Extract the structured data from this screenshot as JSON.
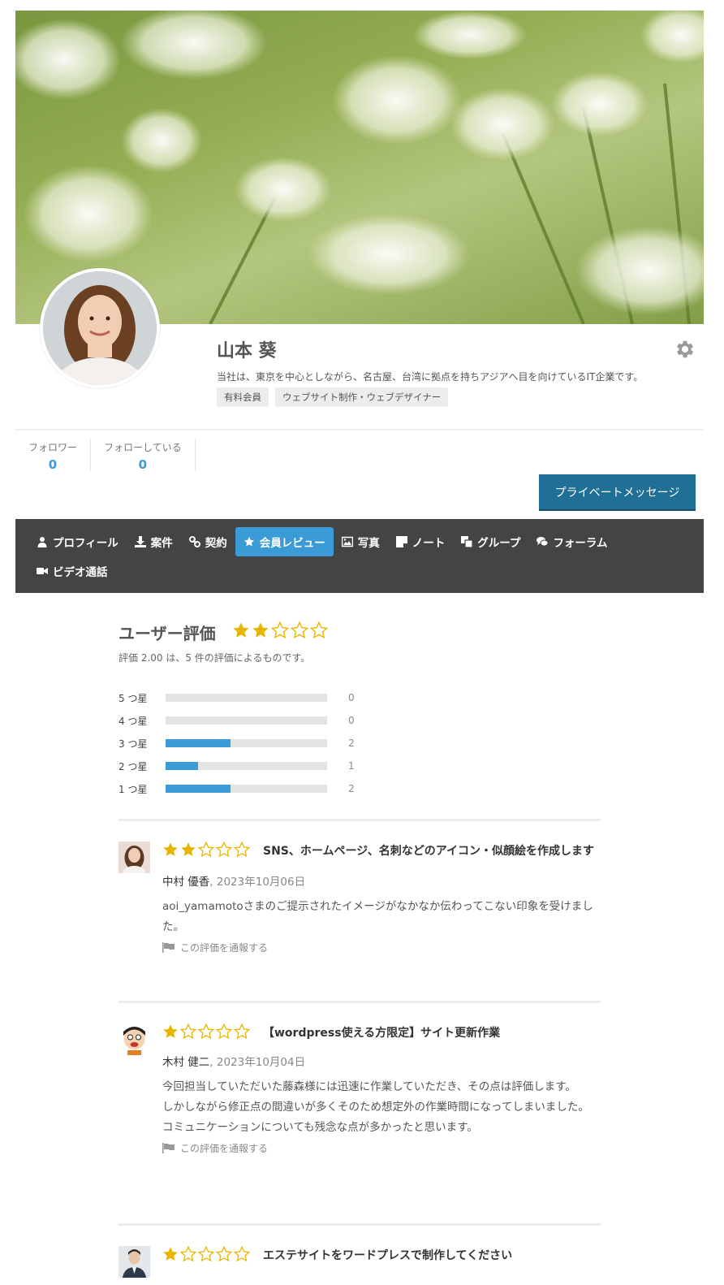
{
  "profile": {
    "name": "山本 葵",
    "description": "当社は、東京を中心としながら、名古屋、台湾に拠点を持ちアジアへ目を向けているIT企業です。",
    "tags": [
      "有料会員",
      "ウェブサイト制作・ウェブデザイナー"
    ]
  },
  "stats": {
    "followers_label": "フォロワー",
    "followers_count": "0",
    "following_label": "フォローしている",
    "following_count": "0"
  },
  "actions": {
    "private_message": "プライベートメッセージ"
  },
  "nav": {
    "items": [
      {
        "label": "プロフィール",
        "icon": "user-icon"
      },
      {
        "label": "案件",
        "icon": "download-icon"
      },
      {
        "label": "契約",
        "icon": "link-icon"
      },
      {
        "label": "会員レビュー",
        "icon": "star-icon",
        "active": true
      },
      {
        "label": "写真",
        "icon": "image-icon"
      },
      {
        "label": "ノート",
        "icon": "note-icon"
      },
      {
        "label": "グループ",
        "icon": "copy-icon"
      },
      {
        "label": "フォーラム",
        "icon": "comments-icon"
      },
      {
        "label": "ビデオ通話",
        "icon": "video-icon"
      }
    ]
  },
  "rating": {
    "title": "ユーザー評価",
    "stars": 2,
    "summary": "評価 2.00 は、5 件の評価によるものです。",
    "breakdown": [
      {
        "label": "5 つ星",
        "count": "0",
        "fraction": 0
      },
      {
        "label": "4 つ星",
        "count": "0",
        "fraction": 0
      },
      {
        "label": "3 つ星",
        "count": "2",
        "fraction": 0.4
      },
      {
        "label": "2 つ星",
        "count": "1",
        "fraction": 0.2
      },
      {
        "label": "1 つ星",
        "count": "2",
        "fraction": 0.4
      }
    ]
  },
  "reviews": [
    {
      "stars": 2,
      "title": "SNS、ホームページ、名刺などのアイコン・似顔絵を作成します",
      "reviewer": "中村 優香",
      "date": ", 2023年10月06日",
      "text": "aoi_yamamotoさまのご提示されたイメージがなかなか伝わってこない印象を受けました。",
      "report": "この評価を通報する"
    },
    {
      "stars": 1,
      "title": "【wordpress使える方限定】サイト更新作業",
      "reviewer": "木村 健二",
      "date": ", 2023年10月04日",
      "text_lines": [
        "今回担当していただいた藤森様には迅速に作業していただき、その点は評価します。",
        "しかしながら修正点の間違いが多くそのため想定外の作業時間になってしまいました。",
        "コミュニケーションについても残念な点が多かったと思います。"
      ],
      "report": "この評価を通報する"
    },
    {
      "stars": 1,
      "title": "エステサイトをワードプレスで制作してください"
    }
  ],
  "colors": {
    "accent": "#3b9bd6",
    "nav_bg": "#444444",
    "star": "#e8b600",
    "pm_button": "#1f6f96"
  }
}
